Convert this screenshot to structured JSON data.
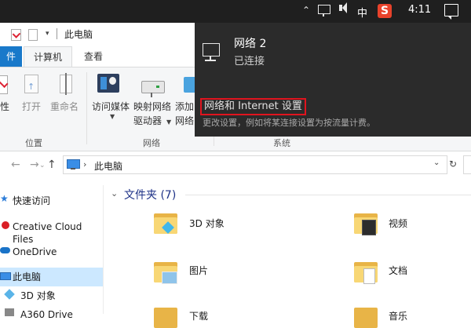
{
  "taskbar": {
    "ime": "中",
    "sogou": "S",
    "clock": "4:11",
    "icons": [
      "chevron-up-icon",
      "network-icon",
      "volume-icon",
      "ime-icon",
      "sogou-icon",
      "notification-icon"
    ]
  },
  "explorer": {
    "title": "此电脑",
    "tabs": {
      "file": "件",
      "computer": "计算机",
      "view": "查看"
    },
    "ribbon": {
      "properties": "性",
      "open": "打开",
      "rename": "重命名",
      "access_media": "访问媒体",
      "map_drive_line1": "映射网络",
      "map_drive_line2": "驱动器",
      "add_line1": "添加",
      "add_line2": "网络",
      "groups": {
        "location": "位置",
        "network": "网络",
        "system": "系统"
      }
    },
    "address": {
      "path": "此电脑"
    },
    "nav": {
      "quick_access": "快速访问",
      "creative_cloud": "Creative Cloud Files",
      "onedrive": "OneDrive",
      "this_pc": "此电脑",
      "objects_3d": "3D 对象",
      "a360": "A360 Drive"
    },
    "content": {
      "section": "文件夹 (7)",
      "folders": {
        "objects_3d": "3D 对象",
        "videos": "视频",
        "pictures": "图片",
        "documents": "文档",
        "downloads": "下载",
        "music": "音乐"
      }
    }
  },
  "flyout": {
    "network_name": "网络 2",
    "status": "已连接",
    "settings_link": "网络和 Internet 设置",
    "settings_desc": "更改设置，例如将某连接设置为按流量计费。"
  },
  "colors": {
    "taskbar": "#1f1f1f",
    "flyout": "#2b2b2b",
    "accent": "#1979ca",
    "highlight_box": "#e0141e",
    "selection": "#cce8ff",
    "folder": "#f8d775"
  }
}
